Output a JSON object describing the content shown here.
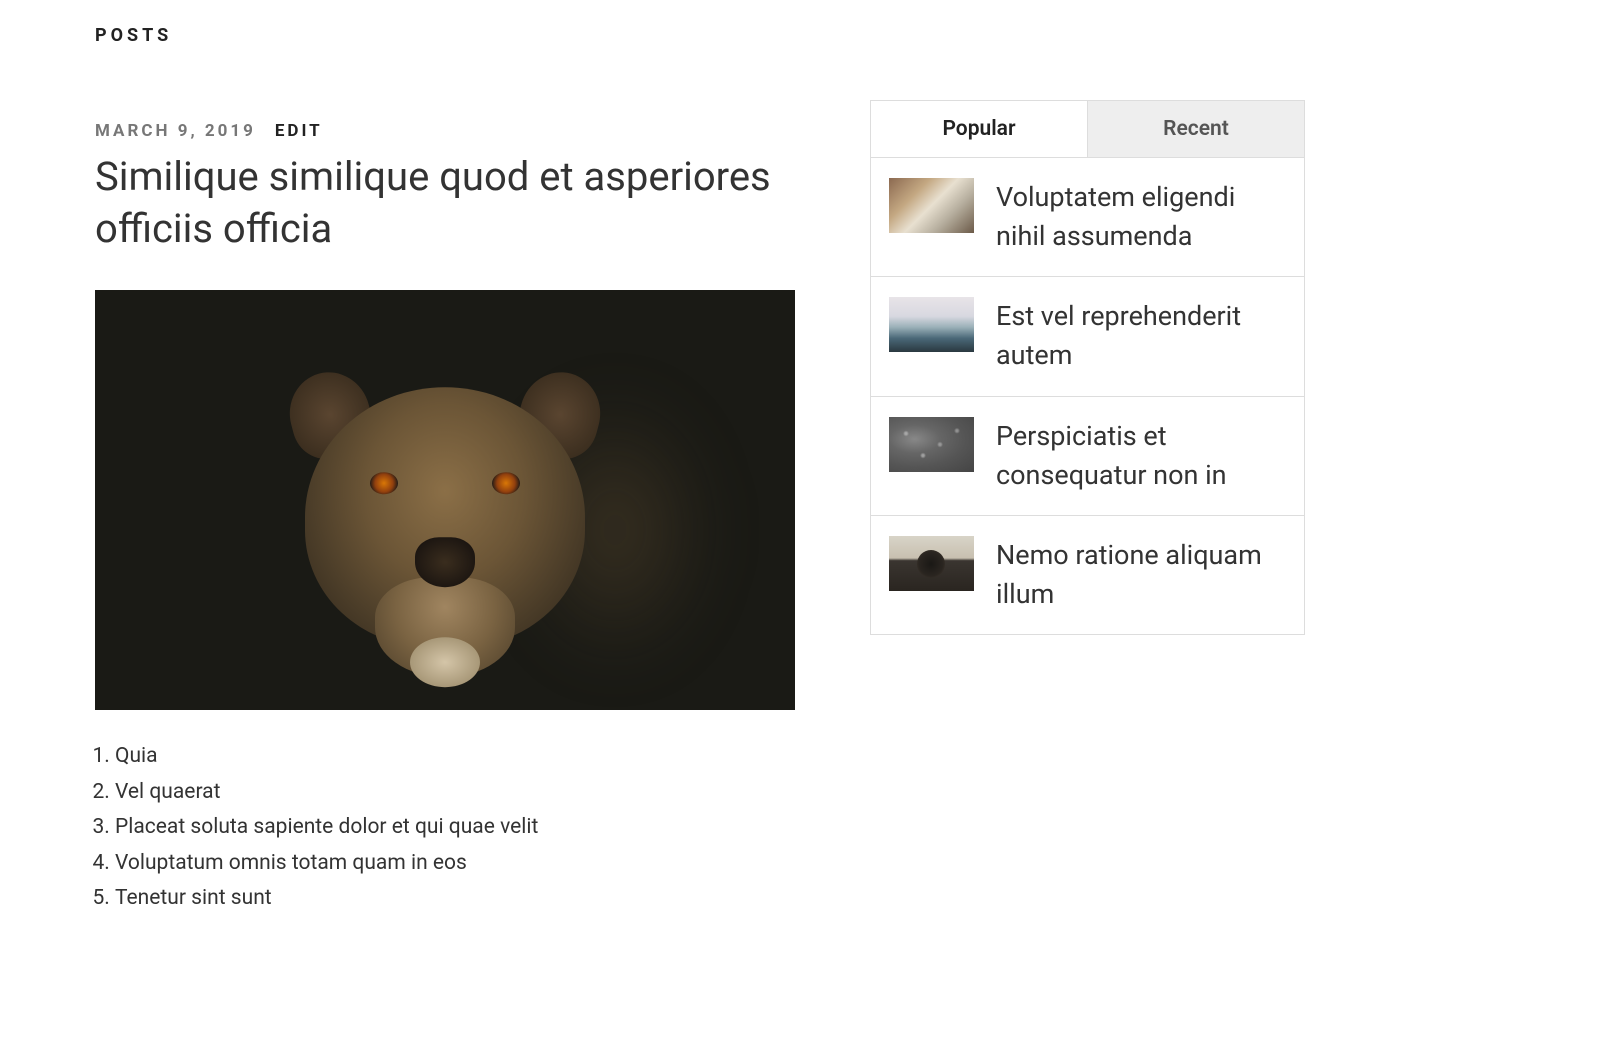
{
  "header": {
    "posts_label": "POSTS"
  },
  "post": {
    "date": "MARCH 9, 2019",
    "edit_label": "EDIT",
    "title": "Similique similique quod et asperiores officiis officia",
    "list_items": [
      "Quia",
      "Vel quaerat",
      "Placeat soluta sapiente dolor et qui quae velit",
      "Voluptatum omnis totam quam in eos",
      "Tenetur sint sunt"
    ]
  },
  "sidebar": {
    "tabs": {
      "popular": "Popular",
      "recent": "Recent",
      "active": "popular"
    },
    "items": [
      {
        "title": "Voluptatem eligendi nihil assumenda",
        "thumb": "thumb-laptop"
      },
      {
        "title": "Est vel reprehenderit autem",
        "thumb": "thumb-landscape"
      },
      {
        "title": "Perspiciatis et consequatur non in",
        "thumb": "thumb-water"
      },
      {
        "title": "Nemo ratione aliquam illum",
        "thumb": "thumb-camera"
      }
    ]
  }
}
